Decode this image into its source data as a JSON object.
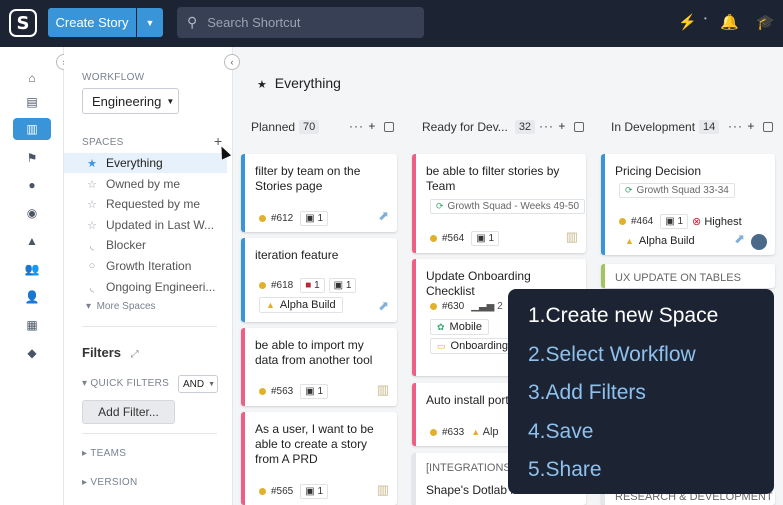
{
  "topbar": {
    "logo_letter": "S",
    "create_story_label": "Create Story",
    "search_placeholder": "Search Shortcut"
  },
  "sidebar": {
    "workflow_label": "WORKFLOW",
    "workflow_value": "Engineering",
    "spaces_label": "SPACES",
    "spaces": [
      {
        "label": "Everything",
        "icon": "star-filled-icon",
        "active": true
      },
      {
        "label": "Owned by me",
        "icon": "star-icon"
      },
      {
        "label": "Requested by me",
        "icon": "star-icon"
      },
      {
        "label": "Updated in Last W...",
        "icon": "star-icon"
      },
      {
        "label": "Blocker",
        "icon": "rss-icon"
      },
      {
        "label": "Growth Iteration",
        "icon": "circle-icon"
      },
      {
        "label": "Ongoing Engineeri...",
        "icon": "rss-icon"
      }
    ],
    "more_spaces": "More Spaces",
    "filters_title": "Filters",
    "quick_filters_label": "QUICK FILTERS",
    "and_value": "AND",
    "add_filter_label": "Add Filter...",
    "teams_label": "TEAMS",
    "version_label": "VERSION"
  },
  "main": {
    "title": "Everything",
    "columns": [
      {
        "name": "Planned",
        "count": "70"
      },
      {
        "name": "Ready for Dev...",
        "count": "32"
      },
      {
        "name": "In Development",
        "count": "14"
      }
    ],
    "cards": [
      {
        "title": "filter by team on the Stories page",
        "id": "#612",
        "tasks": "1"
      },
      {
        "title": "iteration feature",
        "id": "#618",
        "blockers": "1",
        "tasks": "1",
        "label": "Alpha Build"
      },
      {
        "title": "be able to import my data from another tool",
        "id": "#563",
        "tasks": "1"
      },
      {
        "title": "As a user, I want to be able to create a story from A PRD",
        "id": "#565",
        "tasks": "1"
      },
      {
        "title": "be able to filter stories by Team",
        "tag": "Growth Squad - Weeks 49-50",
        "id": "#564",
        "tasks": "1"
      },
      {
        "title": "Update Onboarding Checklist",
        "id": "#630",
        "estimate": "2",
        "label1": "Mobile",
        "label2": "Onboarding"
      },
      {
        "title": "Auto install port",
        "id": "#633",
        "label": "Alp"
      },
      {
        "title": "Shape's Dotlab in... Error",
        "epic": "[INTEGRATIONS]"
      },
      {
        "title": "Pricing Decision",
        "tag": "Growth Squad 33-34",
        "id": "#464",
        "tasks": "1",
        "priority": "Highest",
        "label": "Alpha Build"
      },
      {
        "title": "UX UPDATE ON TABLES"
      },
      {
        "title": "RESEARCH & DEVELOPMENT"
      }
    ]
  },
  "overlay": {
    "steps": [
      "1.Create new Space",
      "2.Select Workflow",
      "3.Add Filters",
      "4.Save",
      "5.Share"
    ]
  }
}
